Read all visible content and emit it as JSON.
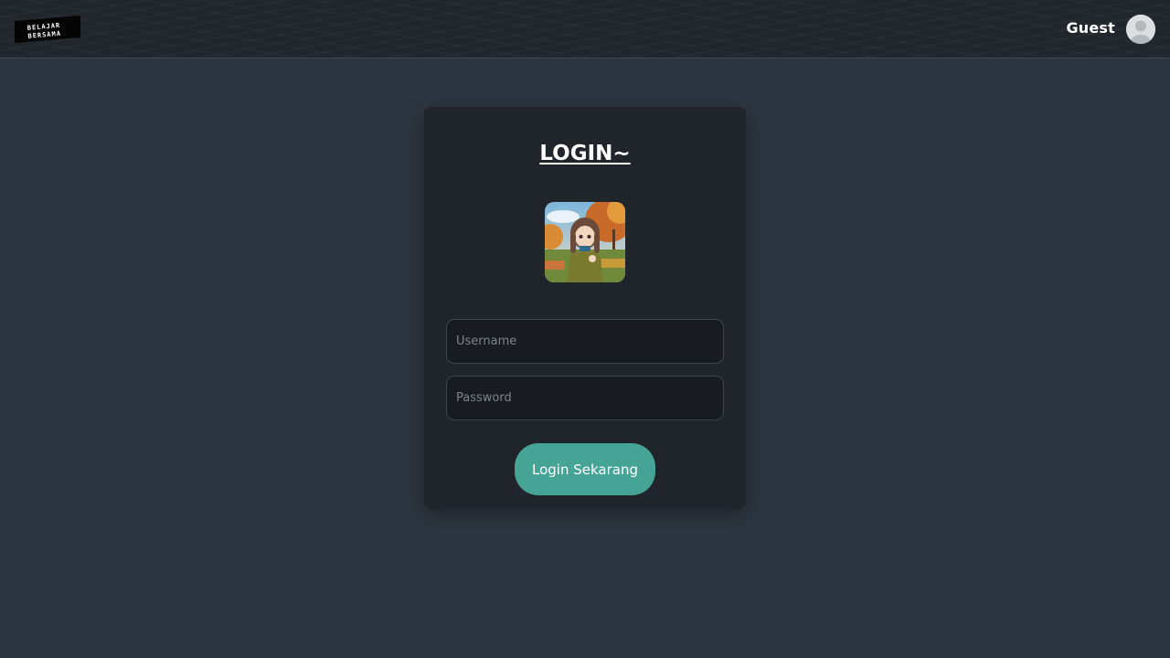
{
  "header": {
    "logo_text_line1": "BELAJAR",
    "logo_text_line2": "BERSAMA",
    "user_name": "Guest"
  },
  "login_card": {
    "title": "LOGIN~",
    "username_placeholder": "Username",
    "password_placeholder": "Password",
    "submit_label": "Login Sekarang"
  },
  "colors": {
    "page_background": "#2d3640",
    "card_background": "#1f252b",
    "accent": "#46a497",
    "header_background": "#20262b"
  }
}
